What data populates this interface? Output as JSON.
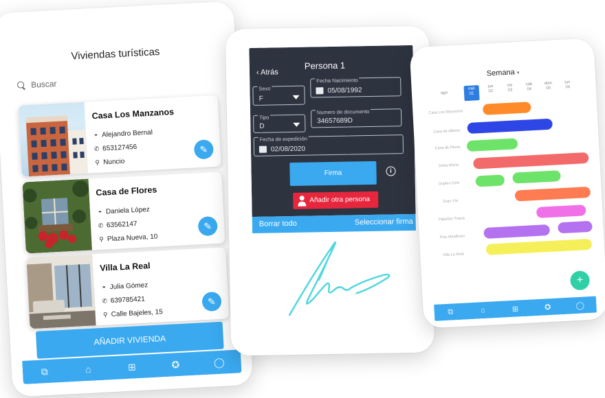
{
  "phone_listing": {
    "title": "Viviendas turísticas",
    "search": {
      "placeholder": "Buscar"
    },
    "cards": [
      {
        "name": "Casa Los Manzanos",
        "owner": "Alejandro Bernal",
        "phone": "653127456",
        "location": "Nuncio"
      },
      {
        "name": "Casa de Flores",
        "owner": "Daniela López",
        "phone": "63562147",
        "location": "Plaza Nueva, 10"
      },
      {
        "name": "Villa La Real",
        "owner": "Julia Gómez",
        "phone": "639785421",
        "location": "Calle Bajeles, 15"
      }
    ],
    "add_button": "AÑADIR VIVIENDA",
    "tabs": [
      "cards-icon",
      "home-icon",
      "add-note-icon",
      "badge-icon",
      "chat-icon"
    ]
  },
  "phone_person": {
    "back": "Atrás",
    "title": "Persona 1",
    "fields": {
      "sexo": {
        "label": "Sexo",
        "value": "F"
      },
      "fecha_nacimiento": {
        "label": "Fecha Nacimiento",
        "value": "05/08/1992"
      },
      "tipo": {
        "label": "Tipo",
        "value": "D"
      },
      "numero_documento": {
        "label": "Numero de documento",
        "value": "34657689D"
      },
      "fecha_expedicion": {
        "label": "Fecha de expedición",
        "value": "02/08/2020"
      }
    },
    "firma_button": "Firma",
    "add_person_button": "Añadir otra persona",
    "signature_bar": {
      "clear": "Borrar todo",
      "select": "Seleccionar firma"
    },
    "colors": {
      "dark_bg": "#2e3340",
      "accent": "#3aa9f0",
      "danger": "#e6263c",
      "signature": "#52d6e0"
    }
  },
  "phone_calendar": {
    "title": "Semana",
    "month": "ago",
    "days": [
      {
        "name": "mié",
        "num": "01",
        "active": true
      },
      {
        "name": "jue",
        "num": "02"
      },
      {
        "name": "vie",
        "num": "03"
      },
      {
        "name": "sáb",
        "num": "04"
      },
      {
        "name": "dom",
        "num": "05"
      },
      {
        "name": "lun",
        "num": "06"
      }
    ],
    "rows": [
      "Casa Los Manzanos",
      "Casa de Alberto",
      "Casa de Flores",
      "Doña María",
      "Duplex Cintr.",
      "Gran Vía",
      "Pabellón Triana",
      "Piso Miraflores",
      "Villa La Real"
    ],
    "fab": "+",
    "colors": {
      "orange": "#ff8a2a",
      "blue": "#2f46e6",
      "green": "#6ee36a",
      "salmon": "#f26a6a",
      "coral": "#ff7b52",
      "magenta": "#f070e8",
      "purple": "#b471f0",
      "yellow": "#f5f05a",
      "fab": "#2fd0a6"
    }
  }
}
